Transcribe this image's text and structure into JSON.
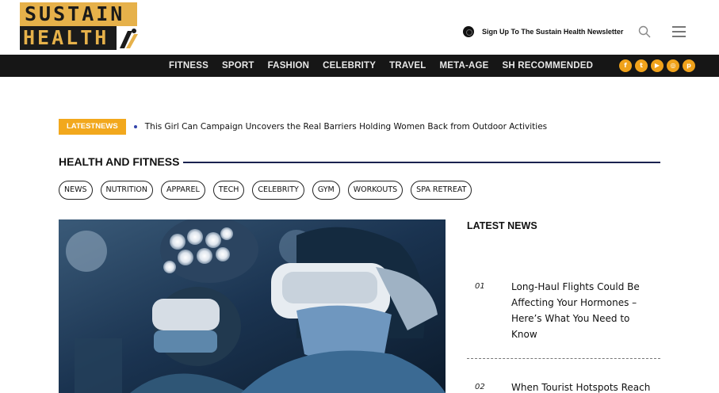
{
  "header": {
    "logo_line1": "SUSTAIN",
    "logo_line2": "HEALTH",
    "newsletter_label": "Sign Up To The Sustain Health Newsletter",
    "icons": [
      "newsletter-icon",
      "search-icon",
      "hamburger-menu-icon"
    ]
  },
  "nav": {
    "items": [
      "FITNESS",
      "SPORT",
      "FASHION",
      "CELEBRITY",
      "TRAVEL",
      "META-AGE",
      "SH RECOMMENDED"
    ],
    "socials": [
      {
        "name": "facebook-icon",
        "glyph": "f"
      },
      {
        "name": "twitter-icon",
        "glyph": "t"
      },
      {
        "name": "youtube-icon",
        "glyph": "▶"
      },
      {
        "name": "instagram-icon",
        "glyph": "◎"
      },
      {
        "name": "pinterest-icon",
        "glyph": "p"
      }
    ],
    "accent": "#f0a21b"
  },
  "ticker": {
    "label": "LATESTNEWS",
    "headline": "This Girl Can Campaign Uncovers the Real Barriers Holding Women Back from Outdoor Activities"
  },
  "section": {
    "title": "HEALTH AND FITNESS",
    "tags": [
      "NEWS",
      "NUTRITION",
      "APPAREL",
      "TECH",
      "CELEBRITY",
      "GYM",
      "WORKOUTS",
      "SPA RETREAT"
    ]
  },
  "sidebar": {
    "title": "LATEST NEWS",
    "items": [
      {
        "num": "01",
        "title": "Long-Haul Flights Could Be Affecting Your Hormones – Here’s What You Need to Know"
      },
      {
        "num": "02",
        "title": "When Tourist Hotspots Reach"
      }
    ]
  }
}
